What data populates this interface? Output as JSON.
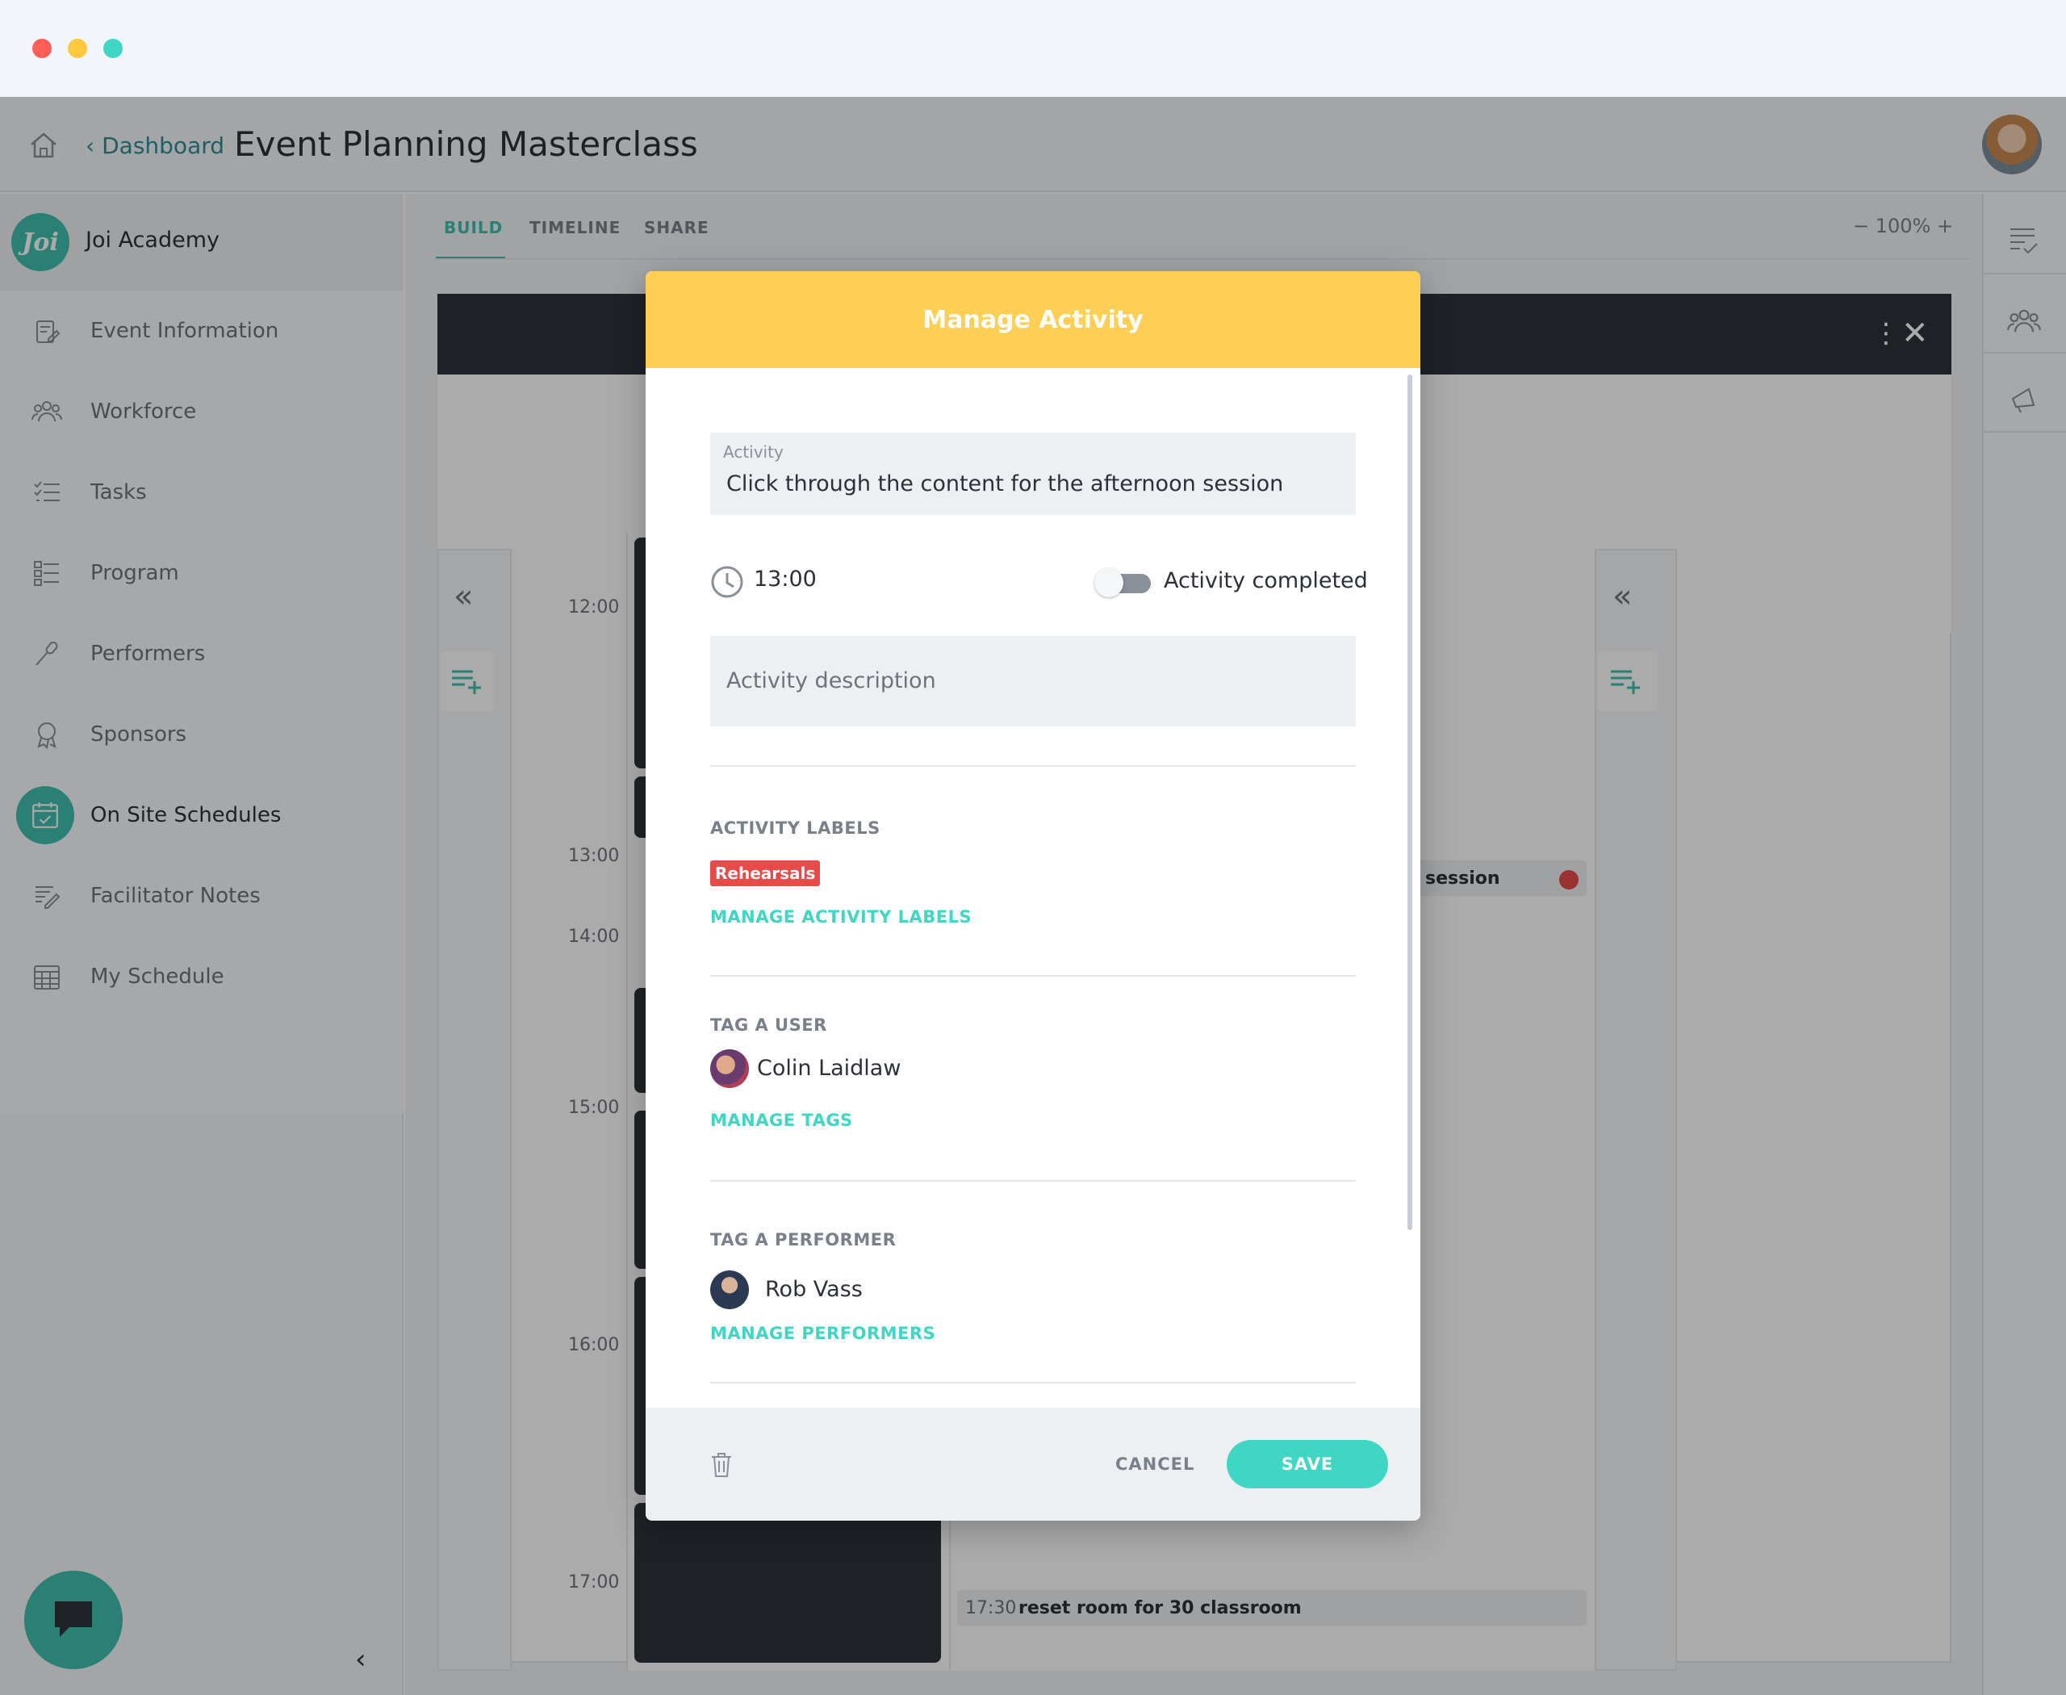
{
  "header": {
    "back_link": "Dashboard",
    "title": "Event Planning Masterclass"
  },
  "sidebar": {
    "org_name": "Joi Academy",
    "logo_text": "Joi",
    "items": [
      {
        "label": "Event Information",
        "icon": "clipboard-edit-icon"
      },
      {
        "label": "Workforce",
        "icon": "people-icon"
      },
      {
        "label": "Tasks",
        "icon": "checklist-icon"
      },
      {
        "label": "Program",
        "icon": "program-list-icon"
      },
      {
        "label": "Performers",
        "icon": "microphone-icon"
      },
      {
        "label": "Sponsors",
        "icon": "award-icon"
      },
      {
        "label": "On Site Schedules",
        "icon": "calendar-check-icon",
        "active": true
      },
      {
        "label": "Facilitator Notes",
        "icon": "notes-edit-icon"
      },
      {
        "label": "My Schedule",
        "icon": "calendar-grid-icon"
      }
    ]
  },
  "tabs": [
    {
      "label": "BUILD",
      "active": true
    },
    {
      "label": "TIMELINE"
    },
    {
      "label": "SHARE"
    }
  ],
  "zoom": {
    "minus": "−",
    "value": "100%",
    "plus": "+"
  },
  "schedule": {
    "times": [
      "12:00",
      "13:00",
      "14:00",
      "15:00",
      "16:00",
      "17:00"
    ],
    "visible_activity": "session",
    "bottom_activity_time": "17:30",
    "bottom_activity_label": "reset room for 30 classroom"
  },
  "modal": {
    "title": "Manage Activity",
    "activity_label": "Activity",
    "activity_value": "Click through the content for the afternoon session",
    "time": "13:00",
    "completed_label": "Activity completed",
    "completed": false,
    "description_placeholder": "Activity description",
    "labels_heading": "ACTIVITY LABELS",
    "labels": [
      {
        "text": "Rehearsals",
        "color": "#e84a4a"
      }
    ],
    "manage_labels": "MANAGE ACTIVITY LABELS",
    "tag_user_heading": "TAG A USER",
    "tagged_user": "Colin Laidlaw",
    "manage_tags": "MANAGE TAGS",
    "tag_performer_heading": "TAG A PERFORMER",
    "tagged_performer": "Rob Vass",
    "manage_performers": "MANAGE PERFORMERS",
    "cancel": "CANCEL",
    "save": "SAVE"
  },
  "colors": {
    "accent": "#3fd6c4",
    "header_yellow": "#ffcf55",
    "label_red": "#e84a4a",
    "dark": "#2e333b"
  }
}
